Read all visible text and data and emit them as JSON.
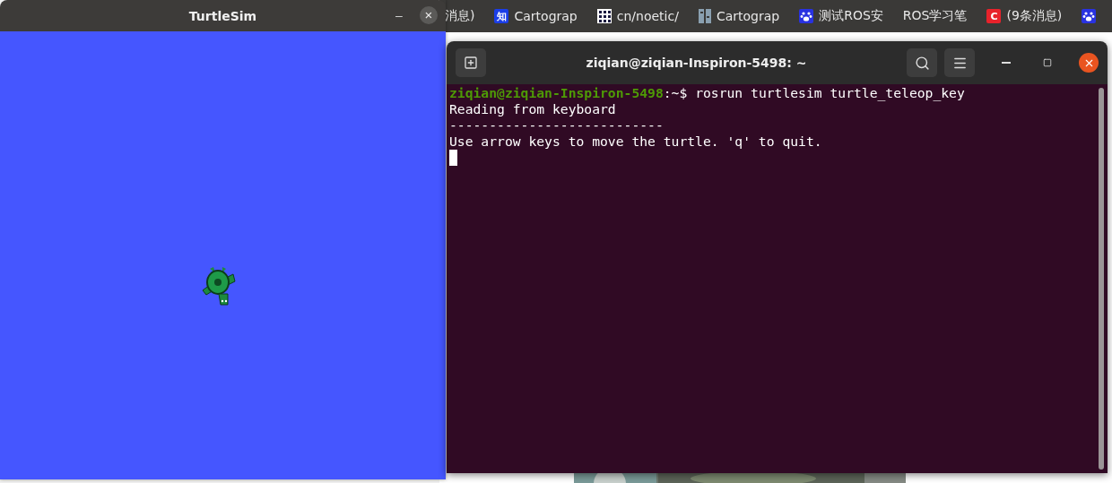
{
  "browser_tabs": [
    {
      "title": "消息)"
    },
    {
      "badge": "知",
      "title": "Cartograp"
    },
    {
      "title": "cn/noetic/"
    },
    {
      "title": "Cartograp"
    },
    {
      "title": "测试ROS安"
    },
    {
      "title": "ROS学习笔"
    },
    {
      "badge": "C",
      "title": "(9条消息)"
    }
  ],
  "turtlesim": {
    "title": "TurtleSim",
    "minimize": "–",
    "close": "×"
  },
  "terminal": {
    "title": "ziqian@ziqian-Inspiron-5498: ~",
    "lines": [
      {
        "kind": "prompt",
        "user": "ziqian@ziqian-Inspiron-5498",
        "path": ":~$",
        "command": "rosrun turtlesim turtle_teleop_key"
      },
      {
        "kind": "output",
        "text": "Reading from keyboard"
      },
      {
        "kind": "output",
        "text": "---------------------------"
      },
      {
        "kind": "output",
        "text": "Use arrow keys to move the turtle. 'q' to quit."
      },
      {
        "kind": "cursor"
      }
    ]
  }
}
